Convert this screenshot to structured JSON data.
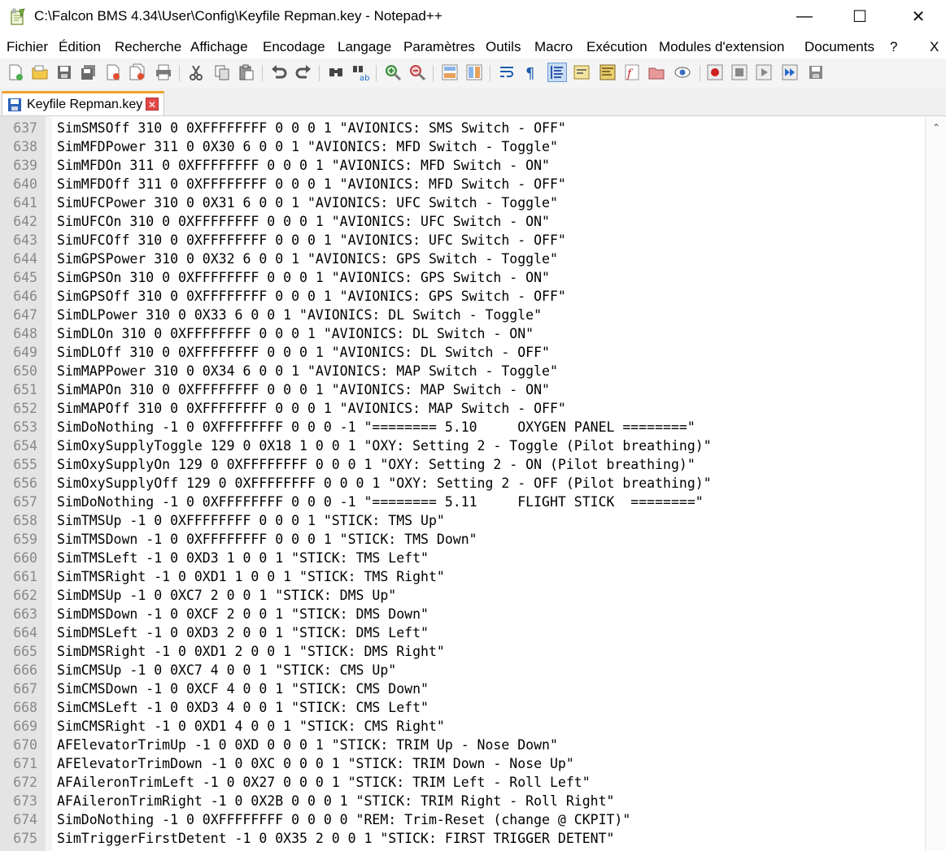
{
  "window": {
    "title": "C:\\Falcon BMS 4.34\\User\\Config\\Keyfile Repman.key - Notepad++",
    "minimize": "—",
    "maximize": "☐",
    "close": "✕"
  },
  "menu": {
    "items": [
      "Fichier",
      "Édition",
      "Recherche",
      "Affichage",
      "Encodage",
      "Langage",
      "Paramètres",
      "Outils",
      "Macro",
      "Exécution",
      "Modules d'extension",
      "Documents",
      "?"
    ],
    "close": "X"
  },
  "toolbar": {
    "icons": [
      "new-file-icon",
      "open-file-icon",
      "save-icon",
      "save-all-icon",
      "close-icon",
      "close-all-icon",
      "print-icon",
      "cut-icon",
      "copy-icon",
      "paste-icon",
      "undo-icon",
      "redo-icon",
      "find-icon",
      "replace-icon",
      "zoom-in-icon",
      "zoom-out-icon",
      "sync-vertical-icon",
      "sync-horizontal-icon",
      "word-wrap-icon",
      "show-all-chars-icon",
      "indent-guide-icon",
      "udl-icon",
      "doc-map-icon",
      "function-list-icon",
      "folder-workspace-icon",
      "monitoring-icon",
      "record-macro-icon",
      "stop-macro-icon",
      "play-macro-icon",
      "run-macro-multiple-icon",
      "save-macro-icon"
    ]
  },
  "tab": {
    "label": "Keyfile Repman.key",
    "close": "✕"
  },
  "editor": {
    "lines": [
      {
        "n": "637",
        "text": "SimSMSOff 310 0 0XFFFFFFFF 0 0 0 1 \"AVIONICS: SMS Switch - OFF\""
      },
      {
        "n": "638",
        "text": "SimMFDPower 311 0 0X30 6 0 0 1 \"AVIONICS: MFD Switch - Toggle\""
      },
      {
        "n": "639",
        "text": "SimMFDOn 311 0 0XFFFFFFFF 0 0 0 1 \"AVIONICS: MFD Switch - ON\""
      },
      {
        "n": "640",
        "text": "SimMFDOff 311 0 0XFFFFFFFF 0 0 0 1 \"AVIONICS: MFD Switch - OFF\""
      },
      {
        "n": "641",
        "text": "SimUFCPower 310 0 0X31 6 0 0 1 \"AVIONICS: UFC Switch - Toggle\""
      },
      {
        "n": "642",
        "text": "SimUFCOn 310 0 0XFFFFFFFF 0 0 0 1 \"AVIONICS: UFC Switch - ON\""
      },
      {
        "n": "643",
        "text": "SimUFCOff 310 0 0XFFFFFFFF 0 0 0 1 \"AVIONICS: UFC Switch - OFF\""
      },
      {
        "n": "644",
        "text": "SimGPSPower 310 0 0X32 6 0 0 1 \"AVIONICS: GPS Switch - Toggle\""
      },
      {
        "n": "645",
        "text": "SimGPSOn 310 0 0XFFFFFFFF 0 0 0 1 \"AVIONICS: GPS Switch - ON\""
      },
      {
        "n": "646",
        "text": "SimGPSOff 310 0 0XFFFFFFFF 0 0 0 1 \"AVIONICS: GPS Switch - OFF\""
      },
      {
        "n": "647",
        "text": "SimDLPower 310 0 0X33 6 0 0 1 \"AVIONICS: DL Switch - Toggle\""
      },
      {
        "n": "648",
        "text": "SimDLOn 310 0 0XFFFFFFFF 0 0 0 1 \"AVIONICS: DL Switch - ON\""
      },
      {
        "n": "649",
        "text": "SimDLOff 310 0 0XFFFFFFFF 0 0 0 1 \"AVIONICS: DL Switch - OFF\""
      },
      {
        "n": "650",
        "text": "SimMAPPower 310 0 0X34 6 0 0 1 \"AVIONICS: MAP Switch - Toggle\""
      },
      {
        "n": "651",
        "text": "SimMAPOn 310 0 0XFFFFFFFF 0 0 0 1 \"AVIONICS: MAP Switch - ON\""
      },
      {
        "n": "652",
        "text": "SimMAPOff 310 0 0XFFFFFFFF 0 0 0 1 \"AVIONICS: MAP Switch - OFF\""
      },
      {
        "n": "653",
        "text": "SimDoNothing -1 0 0XFFFFFFFF 0 0 0 -1 \"======== 5.10     OXYGEN PANEL ========\""
      },
      {
        "n": "654",
        "text": "SimOxySupplyToggle 129 0 0X18 1 0 0 1 \"OXY: Setting 2 - Toggle (Pilot breathing)\""
      },
      {
        "n": "655",
        "text": "SimOxySupplyOn 129 0 0XFFFFFFFF 0 0 0 1 \"OXY: Setting 2 - ON (Pilot breathing)\""
      },
      {
        "n": "656",
        "text": "SimOxySupplyOff 129 0 0XFFFFFFFF 0 0 0 1 \"OXY: Setting 2 - OFF (Pilot breathing)\""
      },
      {
        "n": "657",
        "text": "SimDoNothing -1 0 0XFFFFFFFF 0 0 0 -1 \"======== 5.11     FLIGHT STICK  ========\""
      },
      {
        "n": "658",
        "text": "SimTMSUp -1 0 0XFFFFFFFF 0 0 0 1 \"STICK: TMS Up\""
      },
      {
        "n": "659",
        "text": "SimTMSDown -1 0 0XFFFFFFFF 0 0 0 1 \"STICK: TMS Down\""
      },
      {
        "n": "660",
        "text": "SimTMSLeft -1 0 0XD3 1 0 0 1 \"STICK: TMS Left\""
      },
      {
        "n": "661",
        "text": "SimTMSRight -1 0 0XD1 1 0 0 1 \"STICK: TMS Right\""
      },
      {
        "n": "662",
        "text": "SimDMSUp -1 0 0XC7 2 0 0 1 \"STICK: DMS Up\""
      },
      {
        "n": "663",
        "text": "SimDMSDown -1 0 0XCF 2 0 0 1 \"STICK: DMS Down\""
      },
      {
        "n": "664",
        "text": "SimDMSLeft -1 0 0XD3 2 0 0 1 \"STICK: DMS Left\""
      },
      {
        "n": "665",
        "text": "SimDMSRight -1 0 0XD1 2 0 0 1 \"STICK: DMS Right\""
      },
      {
        "n": "666",
        "text": "SimCMSUp -1 0 0XC7 4 0 0 1 \"STICK: CMS Up\""
      },
      {
        "n": "667",
        "text": "SimCMSDown -1 0 0XCF 4 0 0 1 \"STICK: CMS Down\""
      },
      {
        "n": "668",
        "text": "SimCMSLeft -1 0 0XD3 4 0 0 1 \"STICK: CMS Left\""
      },
      {
        "n": "669",
        "text": "SimCMSRight -1 0 0XD1 4 0 0 1 \"STICK: CMS Right\""
      },
      {
        "n": "670",
        "text": "AFElevatorTrimUp -1 0 0XD 0 0 0 1 \"STICK: TRIM Up - Nose Down\""
      },
      {
        "n": "671",
        "text": "AFElevatorTrimDown -1 0 0XC 0 0 0 1 \"STICK: TRIM Down - Nose Up\""
      },
      {
        "n": "672",
        "text": "AFAileronTrimLeft -1 0 0X27 0 0 0 1 \"STICK: TRIM Left - Roll Left\""
      },
      {
        "n": "673",
        "text": "AFAileronTrimRight -1 0 0X2B 0 0 0 1 \"STICK: TRIM Right - Roll Right\""
      },
      {
        "n": "674",
        "text": "SimDoNothing -1 0 0XFFFFFFFF 0 0 0 0 \"REM: Trim-Reset (change @ CKPIT)\""
      },
      {
        "n": "675",
        "text": "SimTriggerFirstDetent -1 0 0X35 2 0 0 1 \"STICK: FIRST TRIGGER DETENT\""
      }
    ]
  },
  "scrollbar": {
    "up": "⌃"
  }
}
